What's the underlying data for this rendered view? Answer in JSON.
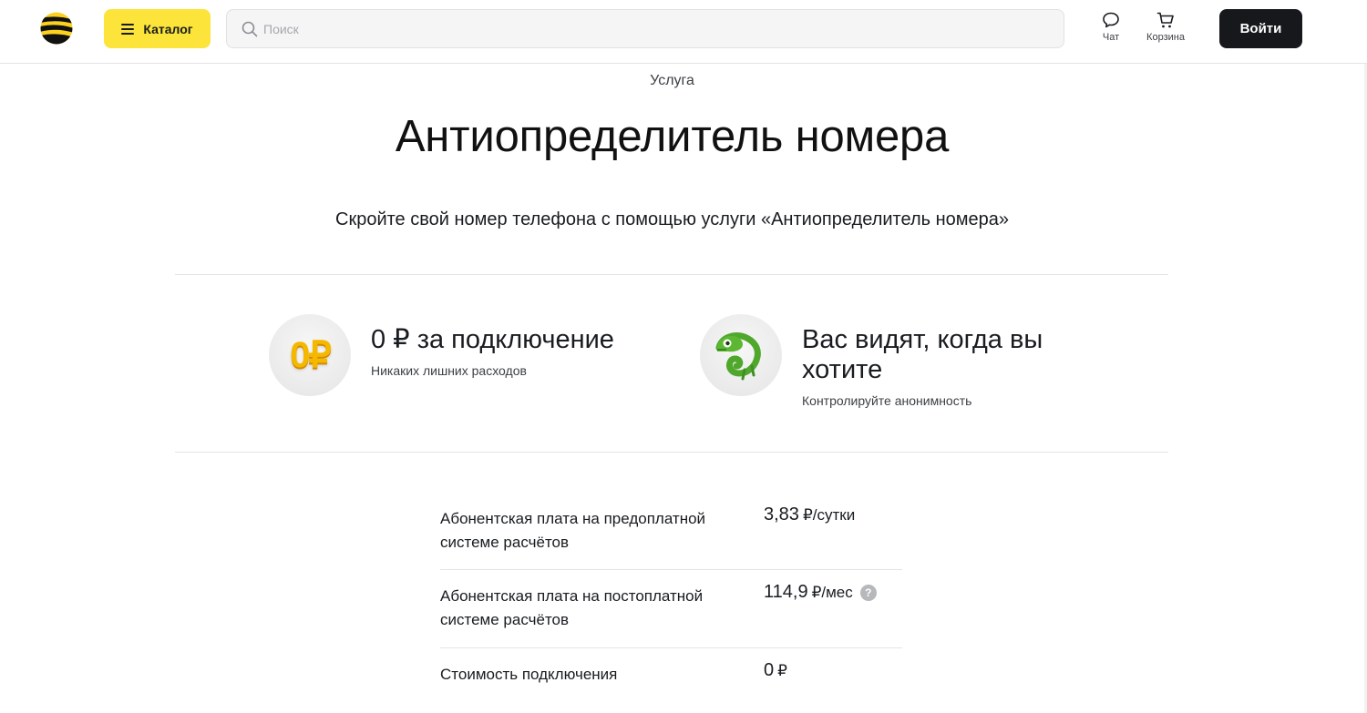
{
  "header": {
    "catalog_label": "Каталог",
    "search_placeholder": "Поиск",
    "chat_label": "Чат",
    "cart_label": "Корзина",
    "login_label": "Войти"
  },
  "hero": {
    "eyebrow": "Услуга",
    "title": "Антиопределитель номера",
    "subtitle": "Скройте свой номер телефона с помощью услуги «Антиопределитель номера»"
  },
  "features": [
    {
      "title": "0 ₽ за подключение",
      "description": "Никаких лишних расходов",
      "icon": "zero-ruble-icon",
      "icon_text": "0₽"
    },
    {
      "title": "Вас видят, когда вы хотите",
      "description": "Контролируйте анонимность",
      "icon": "chameleon-icon"
    }
  ],
  "tariff": [
    {
      "label": "Абонентская плата на предоплатной системе расчётов",
      "value": "3,83",
      "unit": "₽/сутки"
    },
    {
      "label": "Абонентская плата на постоплатной системе расчётов",
      "value": "114,9",
      "unit": "₽/мес",
      "help": "?"
    },
    {
      "label": "Стоимость подключения",
      "value": "0",
      "unit": "₽"
    }
  ],
  "colors": {
    "brand_yellow": "#fce43a",
    "dark": "#16181c"
  }
}
